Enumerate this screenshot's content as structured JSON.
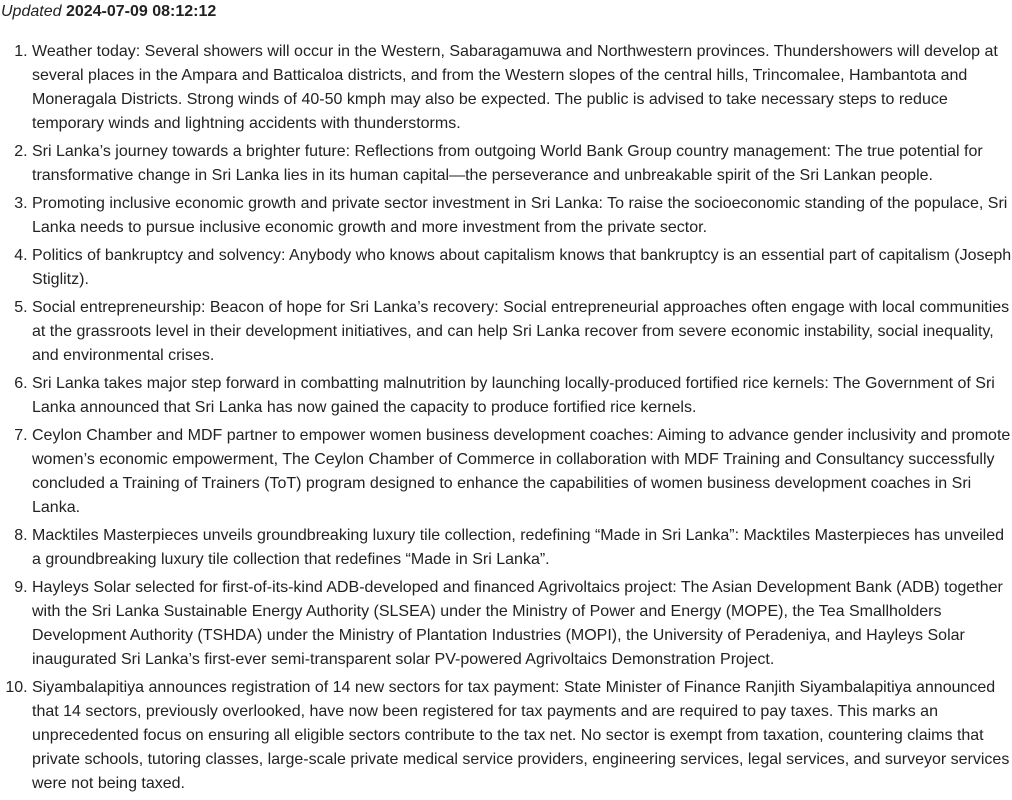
{
  "header": {
    "updated_label": "Updated",
    "updated_time": "2024-07-09 08:12:12"
  },
  "news": [
    "Weather today: Several showers will occur in the Western, Sabaragamuwa and Northwestern provinces. Thundershowers will develop at several places in the Ampara and Batticaloa districts, and from the Western slopes of the central hills, Trincomalee, Hambantota and Moneragala Districts. Strong winds of 40-50 kmph may also be expected. The public is advised to take necessary steps to reduce temporary winds and lightning accidents with thunderstorms.",
    "Sri Lanka’s journey towards a brighter future: Reflections from outgoing World Bank Group country management: The true potential for transformative change in Sri Lanka lies in its human capital—the perseverance and unbreakable spirit of the Sri Lankan people.",
    "Promoting inclusive economic growth and private sector investment in Sri Lanka: To raise the socioeconomic standing of the populace, Sri Lanka needs to pursue inclusive economic growth and more investment from the private sector.",
    "Politics of bankruptcy and solvency: Anybody who knows about capitalism knows that bankruptcy is an essential part of capitalism (Joseph Stiglitz).",
    "Social entrepreneurship: Beacon of hope for Sri Lanka’s recovery: Social entrepreneurial approaches often engage with local communities at the grassroots level in their development initiatives, and can help Sri Lanka recover from severe economic instability, social inequality, and environmental crises.",
    "Sri Lanka takes major step forward in combatting malnutrition by launching locally-produced fortified rice kernels: The Government of Sri Lanka announced that Sri Lanka has now gained the capacity to produce fortified rice kernels.",
    "Ceylon Chamber and MDF partner to empower women business development coaches: Aiming to advance gender inclusivity and promote women’s economic empowerment, The Ceylon Chamber of Commerce in collaboration with MDF Training and Consultancy successfully concluded a Training of Trainers (ToT) program designed to enhance the capabilities of women business development coaches in Sri Lanka.",
    "Macktiles Masterpieces unveils groundbreaking luxury tile collection, redefining “Made in Sri Lanka”: Macktiles Masterpieces has unveiled a groundbreaking luxury tile collection that redefines “Made in Sri Lanka”.",
    "Hayleys Solar selected for first-of-its-kind ADB-developed and financed Agrivoltaics project: The Asian Development Bank (ADB) together with the Sri Lanka Sustainable Energy Authority (SLSEA) under the Ministry of Power and Energy (MOPE), the Tea Smallholders Development Authority (TSHDA) under the Ministry of Plantation Industries (MOPI), the University of Peradeniya, and Hayleys Solar inaugurated Sri Lanka’s first-ever semi-transparent solar PV-powered Agrivoltaics Demonstration Project.",
    "Siyambalapitiya announces registration of 14 new sectors for tax payment: State Minister of Finance Ranjith Siyambalapitiya announced that 14 sectors, previously overlooked, have now been registered for tax payments and are required to pay taxes. This marks an unprecedented focus on ensuring all eligible sectors contribute to the tax net. No sector is exempt from taxation, countering claims that private schools, tutoring classes, large-scale private medical service providers, engineering services, legal services, and surveyor services were not being taxed."
  ]
}
